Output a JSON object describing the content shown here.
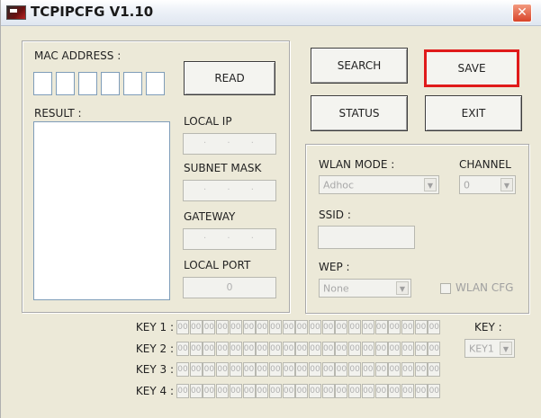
{
  "window": {
    "title": "TCPIPCFG V1.10",
    "close_glyph": "✕"
  },
  "left": {
    "mac_label": "MAC ADDRESS :",
    "read_button": "READ",
    "result_label": "RESULT :",
    "local_ip_label": "LOCAL IP",
    "subnet_label": "SUBNET MASK",
    "gateway_label": "GATEWAY",
    "local_port_label": "LOCAL PORT",
    "local_port_value": "0",
    "ip_dots": ". . ."
  },
  "buttons": {
    "search": "SEARCH",
    "save": "SAVE",
    "status": "STATUS",
    "exit": "EXIT"
  },
  "wlan": {
    "mode_label": "WLAN MODE :",
    "mode_value": "Adhoc",
    "channel_label": "CHANNEL",
    "channel_value": "0",
    "ssid_label": "SSID :",
    "wep_label": "WEP :",
    "wep_value": "None",
    "cfg_label": "WLAN CFG"
  },
  "keys": {
    "labels": [
      "KEY 1 :",
      "KEY 2 :",
      "KEY 3 :",
      "KEY 4 :"
    ],
    "cell_value": "00",
    "select_label": "KEY :",
    "select_value": "KEY1"
  },
  "colors": {
    "highlight": "#e01a1a",
    "face": "#ece9d8"
  },
  "icons": {
    "app": "app-icon",
    "close": "close-icon",
    "dropdown": "chevron-down-icon"
  }
}
